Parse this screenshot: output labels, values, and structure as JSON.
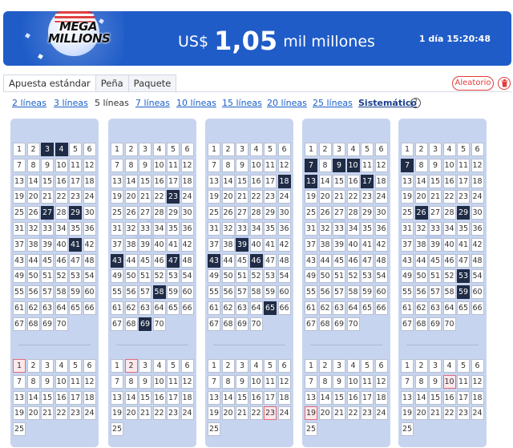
{
  "banner": {
    "logo_line1": "MEGA",
    "logo_line2": "MILLIONS",
    "currency": "US$",
    "amount": "1,05",
    "unit": "mil millones",
    "countdown": "1 día 15:20:48",
    "colors": {
      "background": "#1f5cc8",
      "text": "#ffffff"
    }
  },
  "tabs": [
    {
      "label": "Apuesta estándar",
      "active": true
    },
    {
      "label": "Peña",
      "active": false
    },
    {
      "label": "Paquete",
      "active": false
    }
  ],
  "actions": {
    "random_label": "Aleatorio",
    "delete_icon": "trash-icon",
    "accent": "#e33a3a"
  },
  "line_options": [
    {
      "label": "2 líneas",
      "link": true
    },
    {
      "label": "3 líneas",
      "link": true
    },
    {
      "label": "5 líneas",
      "link": false,
      "current": true
    },
    {
      "label": "7 líneas",
      "link": true
    },
    {
      "label": "10 líneas",
      "link": true
    },
    {
      "label": "15 líneas",
      "link": true
    },
    {
      "label": "20 líneas",
      "link": true
    },
    {
      "label": "25 líneas",
      "link": true
    }
  ],
  "systematic": {
    "label": "Sistemático",
    "help_icon": "help-icon",
    "help_glyph": "?"
  },
  "panels": [
    {
      "watermark": "1",
      "main_selected": [
        3,
        4,
        27,
        29,
        41
      ],
      "mega_selected": [
        1
      ]
    },
    {
      "watermark": "2",
      "main_selected": [
        23,
        43,
        47,
        58,
        69
      ],
      "mega_selected": [
        2
      ]
    },
    {
      "watermark": "3",
      "main_selected": [
        18,
        39,
        43,
        46,
        65
      ],
      "mega_selected": [
        23
      ]
    },
    {
      "watermark": "4",
      "main_selected": [
        7,
        9,
        10,
        13,
        17
      ],
      "mega_selected": [
        19
      ]
    },
    {
      "watermark": "5",
      "main_selected": [
        7,
        26,
        29,
        53,
        59
      ],
      "mega_selected": [
        10
      ]
    }
  ],
  "main_range": 70,
  "mega_range": 25,
  "colors": {
    "panel": "#c7d4ef",
    "selected": "#202b45",
    "mega_selected": "#fde8ea"
  }
}
